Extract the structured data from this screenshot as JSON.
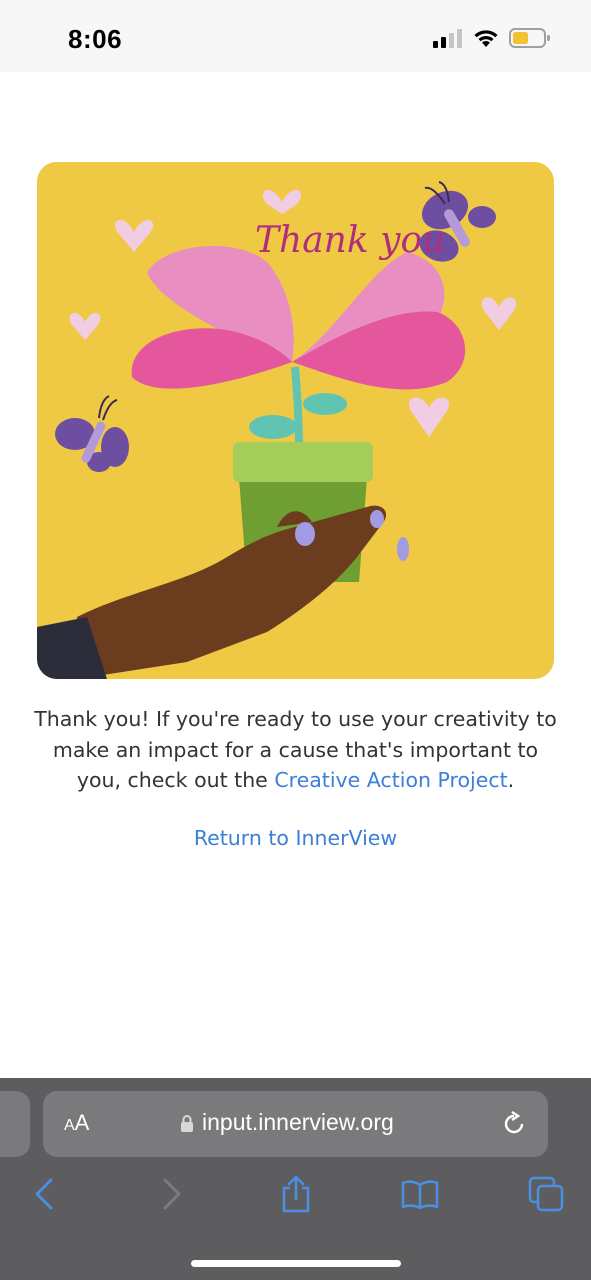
{
  "status_bar": {
    "time": "8:06",
    "icons": [
      "signal-icon",
      "wifi-icon",
      "battery-icon"
    ],
    "battery_color": "#f2c232"
  },
  "content": {
    "hero_image": {
      "lettering": "Thank you",
      "icon": "thank-you-illustration"
    },
    "message": {
      "text_before": "Thank you! If you're ready to use your creativity to make an impact for a cause that's important to you, check out the ",
      "link_label": "Creative Action Project",
      "text_after": "."
    },
    "return_link": "Return to InnerView",
    "link_color": "#3b7fd9"
  },
  "browser": {
    "aa_big": "A",
    "aa_small": "A",
    "url": "input.innerview.org",
    "toolbar": [
      "back-icon",
      "forward-icon",
      "share-icon",
      "bookmarks-icon",
      "tabs-icon"
    ],
    "accent": "#4a90e2"
  }
}
